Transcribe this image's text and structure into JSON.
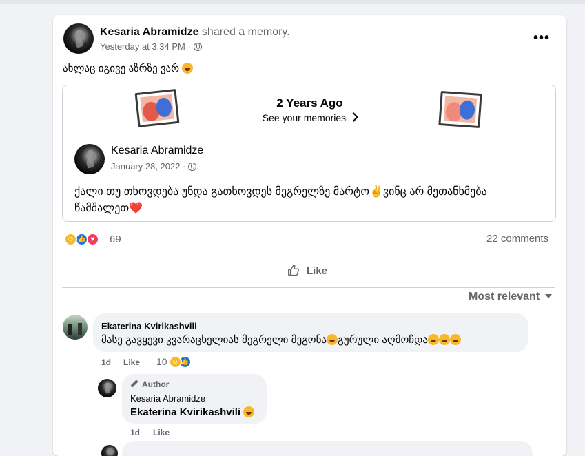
{
  "post": {
    "author": "Kesaria Abramidze",
    "action": "shared a memory.",
    "time": "Yesterday at 3:34 PM ·",
    "text": "ახლაც იგივე აზრზე ვარ",
    "more_label": "•••"
  },
  "memory": {
    "title": "2 Years Ago",
    "link": "See your memories",
    "author": "Kesaria Abramidze",
    "date": "January 28, 2022 ·",
    "text_line1": "ქალი თუ თხოვდება უნდა გათხოვდეს მეგრელზე მარტო✌️ვინც არ მეთანხმება",
    "text_line2": "წამშალეთ❤️"
  },
  "stats": {
    "reaction_count": "69",
    "comments": "22 comments",
    "reaction_icons": [
      "haha-icon",
      "like-icon",
      "love-icon"
    ]
  },
  "actions": {
    "like_label": "Like"
  },
  "sort": {
    "label": "Most relevant"
  },
  "comments": [
    {
      "author": "Ekaterina Kvirikashvili",
      "text": "მასე გავყევი კვარაცხელიას მეგრელი მეგონა",
      "text_mid": "გურული აღმოჩდა",
      "time": "1d",
      "like": "Like",
      "reactions": "10"
    },
    {
      "badge": "Author",
      "author": "Kesaria Abramidze",
      "text": "Ekaterina Kvirikashvili",
      "time": "1d",
      "like": "Like"
    }
  ],
  "colors": {
    "accent": "#1b74e4",
    "haha": "#f7b928",
    "love": "#f33e58",
    "background": "#f0f2f5"
  }
}
